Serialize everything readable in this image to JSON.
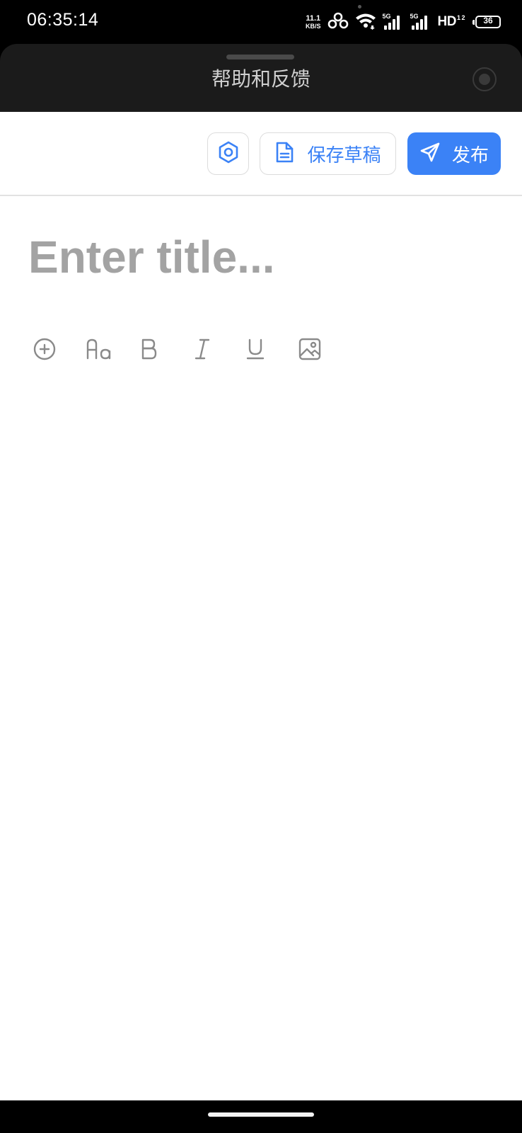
{
  "status_bar": {
    "time": "06:35:14",
    "net_speed_value": "11.1",
    "net_speed_unit": "KB/S",
    "sim1_gen": "5G",
    "sim2_gen": "5G",
    "hd_label": "HD",
    "hd_sub": "1 2",
    "battery_level": "36"
  },
  "sheet": {
    "title": "帮助和反馈"
  },
  "toolbar": {
    "save_draft_label": "保存草稿",
    "publish_label": "发布",
    "accent_color": "#3b82f6"
  },
  "editor": {
    "title_placeholder": "Enter title..."
  },
  "format_bar": {
    "items": [
      "add-icon",
      "font-size-icon",
      "bold-icon",
      "italic-icon",
      "underline-icon",
      "image-icon"
    ]
  }
}
